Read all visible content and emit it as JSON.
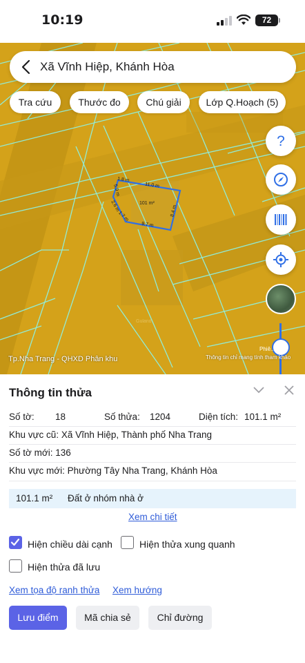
{
  "status_bar": {
    "time": "10:19",
    "battery": "72"
  },
  "search": {
    "location": "Xã Vĩnh Hiệp, Khánh Hòa"
  },
  "chips": [
    "Tra cứu",
    "Thước đo",
    "Chú giải",
    "Lớp Q.Hoạch (5)"
  ],
  "map": {
    "edge_top": "11.0 m",
    "edge_right": "8.4 m",
    "edge_bottom": "9.7 m",
    "edge_left_a": "5.9 m",
    "edge_left_b": "2.6 m",
    "edge_left_c": "1.7 m",
    "edge_corner": "1.8 m",
    "parcel_area": "101 m²",
    "watermark": "Guland",
    "caption": "Tp.Nha Trang - QHXD Phân khu",
    "credit_top": "Phiê... 2",
    "credit": "Thông tin chỉ mang tính tham khảo"
  },
  "sheet": {
    "title": "Thông tin thửa",
    "so_to_label": "Số tờ:",
    "so_to_value": "18",
    "so_thua_label": "Số thửa:",
    "so_thua_value": "1204",
    "dien_tich_label": "Diện tích:",
    "dien_tich_value": "101.1 m²",
    "khu_vuc_cu": "Khu vực cũ: Xã Vĩnh Hiệp, Thành phố Nha Trang",
    "so_to_moi": "Số tờ mới: 136",
    "khu_vuc_moi": "Khu vực mới: Phường Tây Nha Trang, Khánh Hòa",
    "land_area": "101.1 m²",
    "land_type": "Đất ở nhóm nhà ở",
    "detail_link": "Xem chi tiết",
    "check_edges": "Hiện chiều dài cạnh",
    "check_edges_checked": true,
    "check_surrounding": "Hiện thửa xung quanh",
    "check_saved": "Hiện thửa đã lưu",
    "link_coords": "Xem tọa độ ranh thửa",
    "link_direction": "Xem hướng",
    "btn_save": "Lưu điểm",
    "btn_share": "Mã chia sẻ",
    "btn_route": "Chỉ đường"
  },
  "colors": {
    "accent": "#5b63e6",
    "map_fill": "#d4a21a",
    "map_lines": "#8ff0e0",
    "link": "#2e5bd8"
  }
}
